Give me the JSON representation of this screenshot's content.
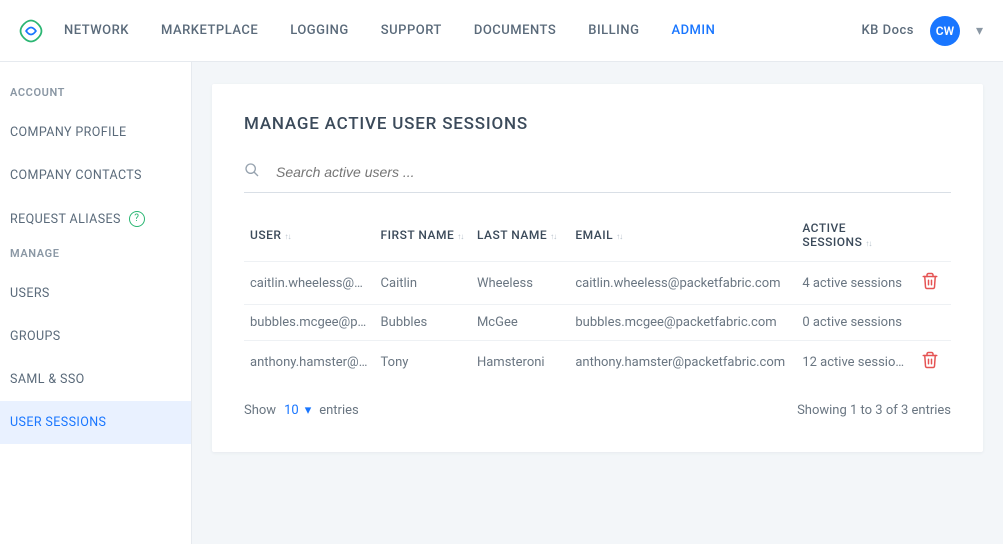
{
  "topnav": {
    "items": [
      "NETWORK",
      "MARKETPLACE",
      "LOGGING",
      "SUPPORT",
      "DOCUMENTS",
      "BILLING",
      "ADMIN"
    ],
    "active_index": 6,
    "kb_docs": "KB Docs",
    "avatar_initials": "CW"
  },
  "sidebar": {
    "groups": [
      {
        "label": "ACCOUNT",
        "items": [
          "COMPANY PROFILE",
          "COMPANY CONTACTS",
          "REQUEST ALIASES"
        ]
      },
      {
        "label": "MANAGE",
        "items": [
          "USERS",
          "GROUPS",
          "SAML & SSO",
          "USER SESSIONS"
        ]
      }
    ],
    "active": "USER SESSIONS"
  },
  "page": {
    "title": "MANAGE ACTIVE USER SESSIONS",
    "search_placeholder": "Search active users ...",
    "columns": [
      "USER",
      "FIRST NAME",
      "LAST NAME",
      "EMAIL",
      "ACTIVE SESSIONS"
    ],
    "rows": [
      {
        "user": "caitlin.wheeless@p…",
        "first": "Caitlin",
        "last": "Wheeless",
        "email": "caitlin.wheeless@packetfabric.com",
        "sessions": "4 active sessions",
        "deletable": true
      },
      {
        "user": "bubbles.mcgee@p…",
        "first": "Bubbles",
        "last": "McGee",
        "email": "bubbles.mcgee@packetfabric.com",
        "sessions": "0 active sessions",
        "deletable": false
      },
      {
        "user": "anthony.hamster@…",
        "first": "Tony",
        "last": "Hamsteroni",
        "email": "anthony.hamster@packetfabric.com",
        "sessions": "12 active sessions",
        "deletable": true
      }
    ],
    "page_size_label_a": "Show",
    "page_size_value": "10",
    "page_size_label_b": "entries",
    "showing_text": "Showing 1 to 3 of 3 entries"
  }
}
